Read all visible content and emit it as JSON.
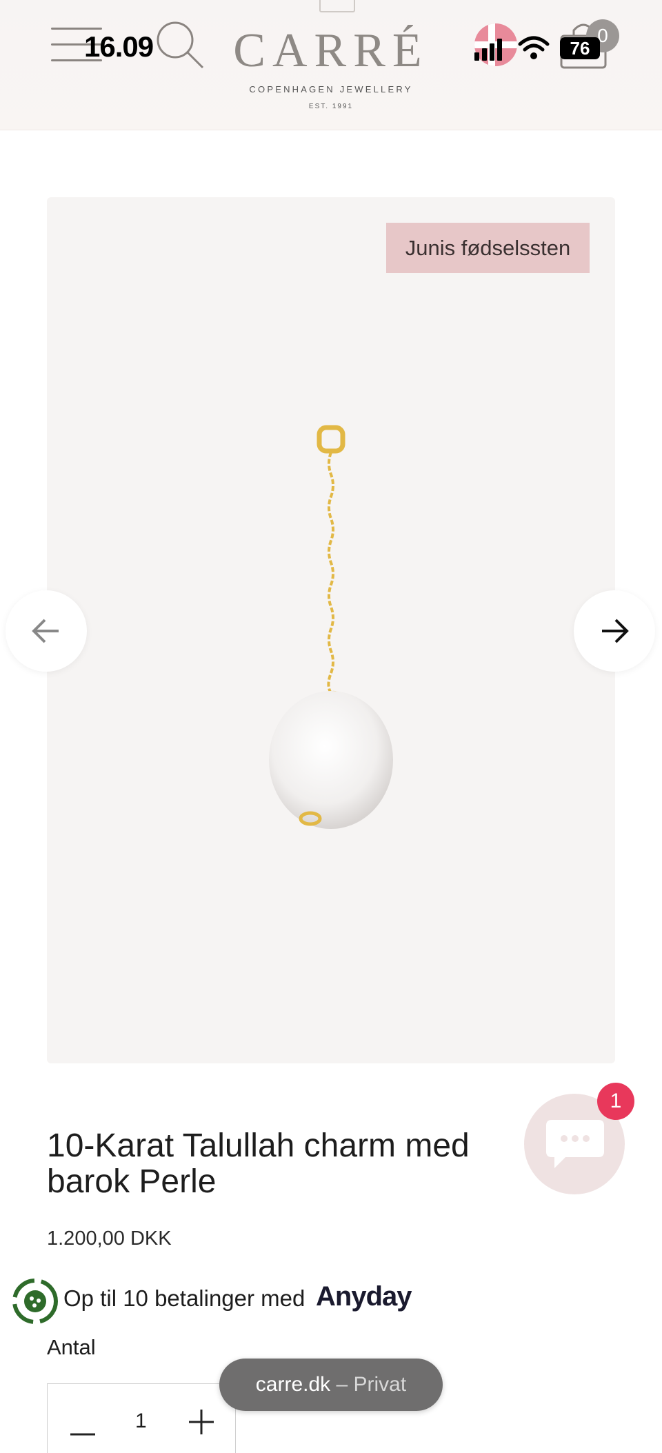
{
  "status_bar": {
    "time": "16.09",
    "battery": "76"
  },
  "header": {
    "logo": "CARRÉ",
    "logo_sub": "COPENHAGEN JEWELLERY",
    "logo_est": "EST. 1991",
    "cart_count": "0"
  },
  "gallery": {
    "badge": "Junis fødselssten"
  },
  "product": {
    "title": "10-Karat Talullah charm med barok Perle",
    "price": "1.200,00 DKK"
  },
  "payment": {
    "text": "Op til 10 betalinger med",
    "logo": "Anyday"
  },
  "quantity": {
    "label": "Antal",
    "value": "1"
  },
  "chat": {
    "unread": "1"
  },
  "browser": {
    "domain": "carre.dk",
    "mode": "– Privat"
  },
  "colors": {
    "accent": "#e8385b",
    "badge_bg": "#e7c7c8",
    "gallery_bg": "#f6f4f3"
  }
}
